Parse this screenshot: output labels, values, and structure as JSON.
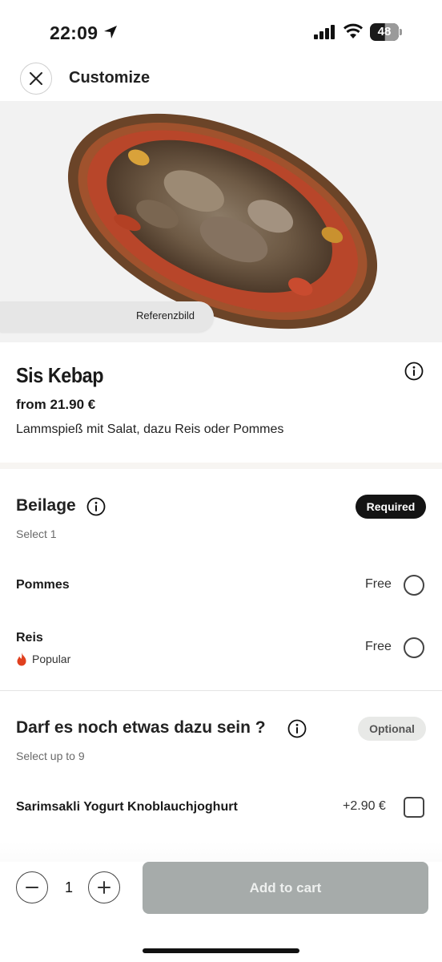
{
  "status_bar": {
    "time": "22:09",
    "battery": "48"
  },
  "header": {
    "title": "Customize"
  },
  "hero": {
    "badge": "Referenzbild"
  },
  "product": {
    "name": "Sis Kebap",
    "price": "from 21.90 €",
    "description": "Lammspieß mit Salat, dazu Reis oder Pommes"
  },
  "sections": [
    {
      "title": "Beilage",
      "subtitle": "Select 1",
      "badge": "Required",
      "options": [
        {
          "label": "Pommes",
          "price": "Free",
          "control": "radio"
        },
        {
          "label": "Reis",
          "price": "Free",
          "control": "radio",
          "tag": "Popular"
        }
      ]
    },
    {
      "title": "Darf es noch etwas dazu sein ?",
      "subtitle": "Select up to 9",
      "badge": "Optional",
      "options": [
        {
          "label": "Sarimsakli Yogurt Knoblauchjoghurt",
          "price": "+2.90 €",
          "control": "checkbox"
        }
      ]
    }
  ],
  "cart": {
    "quantity": "1",
    "button_label": "Add to cart"
  },
  "colors": {
    "required_badge": "#141414",
    "optional_badge": "#e8e9e7",
    "cart_button": "#a6abaa",
    "popular_flame": "#e0401f"
  },
  "icons": [
    "location-arrow-icon",
    "signal-icon",
    "wifi-icon",
    "battery-icon",
    "close-icon",
    "info-icon",
    "flame-icon",
    "minus-icon",
    "plus-icon"
  ]
}
